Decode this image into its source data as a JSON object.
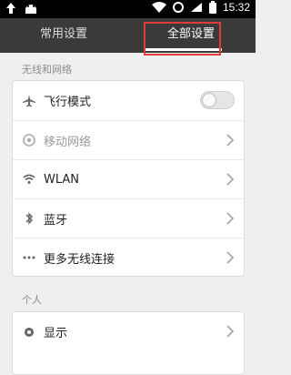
{
  "status": {
    "time": "15:32"
  },
  "tabs": {
    "common": "常用设置",
    "all": "全部设置"
  },
  "sections": {
    "wireless": {
      "title": "无线和网络",
      "items": [
        {
          "label": "飞行模式",
          "icon": "airplane-icon"
        },
        {
          "label": "移动网络",
          "icon": "mobile-network-icon"
        },
        {
          "label": "WLAN",
          "icon": "wifi-icon"
        },
        {
          "label": "蓝牙",
          "icon": "bluetooth-icon"
        },
        {
          "label": "更多无线连接",
          "icon": "more-icon"
        }
      ]
    },
    "personal": {
      "title": "个人",
      "items": [
        {
          "label": "显示",
          "icon": "display-icon"
        }
      ]
    }
  },
  "colors": {
    "highlight": "#e03a3a",
    "tabbar": "#3a3a3a"
  }
}
